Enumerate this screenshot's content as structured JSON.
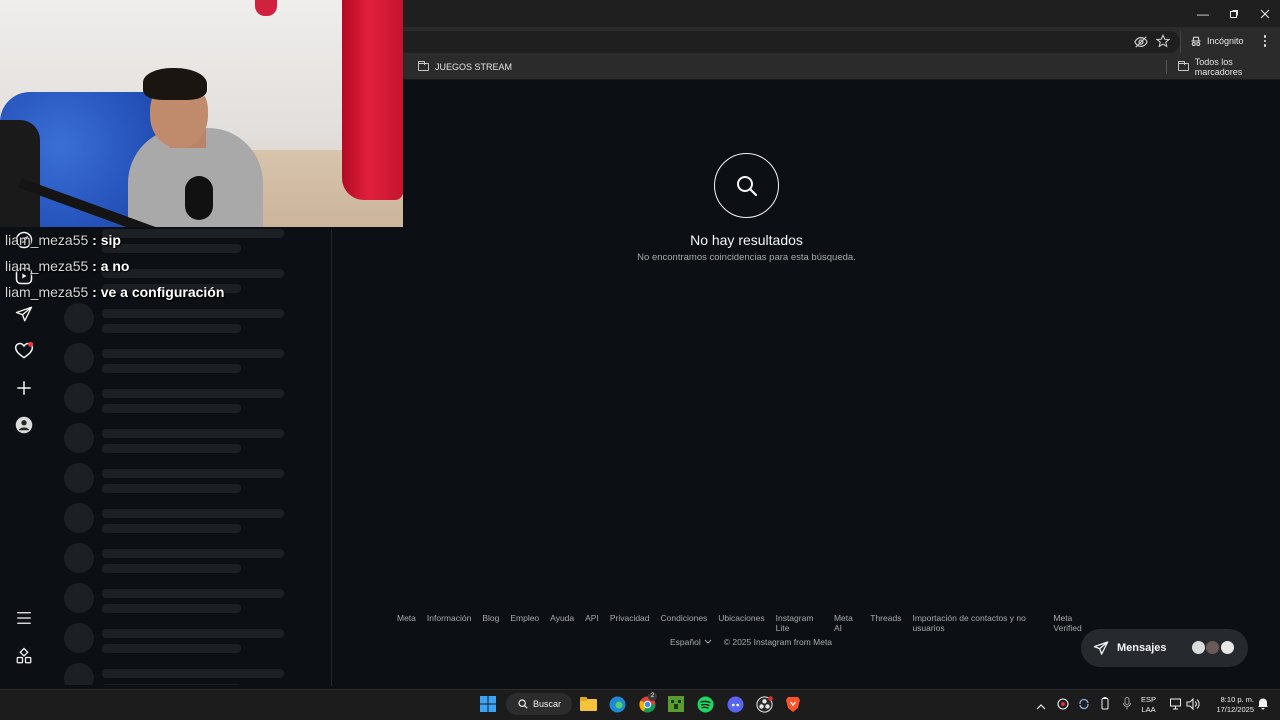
{
  "browser": {
    "incognito_label": "Incógnito",
    "bookmarks": [
      {
        "label": "JUEGOS STREAM"
      },
      {
        "label": "Todos los marcadores"
      }
    ]
  },
  "instagram": {
    "no_results_title": "No hay resultados",
    "no_results_subtitle": "No encontramos coincidencias para esta búsqueda.",
    "footer_links": [
      "Meta",
      "Información",
      "Blog",
      "Empleo",
      "Ayuda",
      "API",
      "Privacidad",
      "Condiciones",
      "Ubicaciones",
      "Instagram Lite",
      "Meta AI",
      "Threads",
      "Importación de contactos y no usuarios",
      "Meta Verified"
    ],
    "language": "Español",
    "copyright": "© 2025 Instagram from Meta",
    "messages_label": "Mensajes",
    "nav_icons": [
      "explore-icon",
      "reels-icon",
      "direct-icon",
      "heart-icon",
      "create-icon",
      "profile-icon",
      "menu-icon",
      "also-from-meta-icon"
    ]
  },
  "stream_chat": [
    {
      "user": "liam_meza55",
      "message": " : sip"
    },
    {
      "user": "liam_meza55",
      "message": " : a no"
    },
    {
      "user": "liam_meza55",
      "message": " : ve a configuración"
    }
  ],
  "taskbar": {
    "search_label": "Buscar",
    "language_line1": "ESP",
    "language_line2": "LAA",
    "time": "8:10 p. m.",
    "date": "17/12/2025",
    "chrome_badge": "2"
  },
  "colors": {
    "page_bg": "#0c1014",
    "skeleton": "#1c1f23",
    "notification_dot": "#ff3040"
  }
}
